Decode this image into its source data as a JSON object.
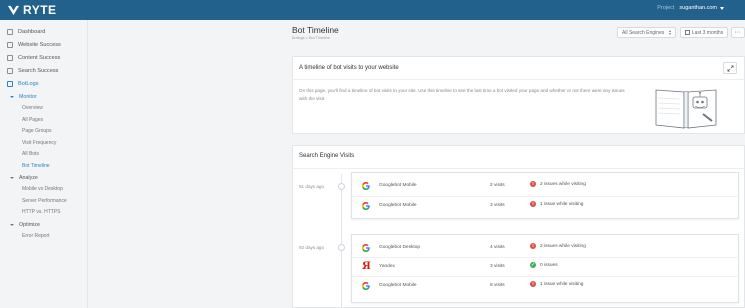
{
  "app": {
    "logo_text": "RYTE",
    "project_label": "Project",
    "project_value": "suganthan.com"
  },
  "sidebar": {
    "items": [
      {
        "label": "Dashboard"
      },
      {
        "label": "Website Success"
      },
      {
        "label": "Content Success"
      },
      {
        "label": "Search Success"
      },
      {
        "label": "BotLogs"
      }
    ],
    "groups": {
      "monitor": {
        "label": "Monitor",
        "items": [
          "Overview",
          "All Pages",
          "Page Groups",
          "Visit Frequency",
          "All Bots",
          "Bot Timeline"
        ]
      },
      "analyze": {
        "label": "Analyze",
        "items": [
          "Mobile vs Desktop",
          "Server Performance",
          "HTTP vs. HTTPS"
        ]
      },
      "optimize": {
        "label": "Optimize",
        "items": [
          "Error Report"
        ]
      }
    }
  },
  "header": {
    "title": "Bot Timeline",
    "breadcrumb": "Botlogs  >  Bot Timeline",
    "engines_select": "All Search Engines",
    "date_range": "Last 3 months",
    "more": "···"
  },
  "intro": {
    "title": "A timeline of bot visits to your website",
    "text": "On this page, you'll find a timeline of bot visits to your site. Use this timeline to see the last time a bot visited your page and whether or not there were any issues with the visit."
  },
  "visits": {
    "title": "Search Engine Visits",
    "days": [
      {
        "label": "91 days ago",
        "rows": [
          {
            "bot": "Googlebot Mobile",
            "icon": "google-icon",
            "visits": "2 visits",
            "status": "2 issues while visiting",
            "ok": false
          },
          {
            "bot": "Googlebot Mobile",
            "icon": "google-icon",
            "visits": "3 visits",
            "status": "1 issue while visiting",
            "ok": false
          }
        ]
      },
      {
        "label": "92 days ago",
        "rows": [
          {
            "bot": "Googlebot Desktop",
            "icon": "google-icon",
            "visits": "4 visits",
            "status": "2 issues while visiting",
            "ok": false
          },
          {
            "bot": "Yandex",
            "icon": "yandex-icon",
            "visits": "3 visits",
            "status": "0 issues",
            "ok": true
          },
          {
            "bot": "Googlebot Mobile",
            "icon": "google-icon",
            "visits": "8 visits",
            "status": "1 issue while visiting",
            "ok": false
          }
        ]
      }
    ]
  },
  "colors": {
    "topbar": "#21618c",
    "accent": "#2d84c4",
    "error": "#e04b4b",
    "success": "#3fae5b"
  }
}
